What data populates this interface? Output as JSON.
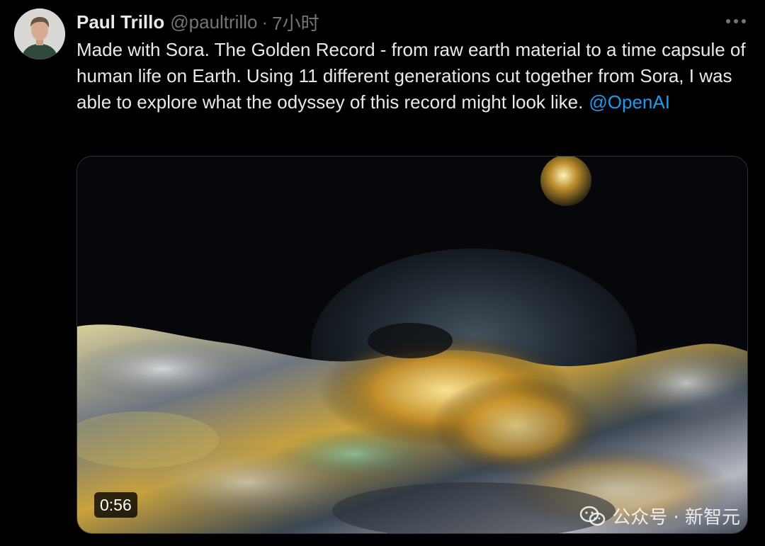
{
  "tweet": {
    "author": {
      "name": "Paul Trillo",
      "handle": "@paultrillo",
      "time": "7小时"
    },
    "separator": "·",
    "text": "Made with Sora. The Golden Record - from raw earth material to a time capsule of human life on Earth. Using 11 different generations cut together from Sora, I was able to explore what the odyssey of this record might look like.",
    "mention": "@OpenAI",
    "media": {
      "type": "video",
      "duration": "0:56"
    }
  },
  "watermark": {
    "text": "公众号 · 新智元"
  },
  "icons": {
    "more": "more-horizontal-icon",
    "watermark": "wechat-icon"
  },
  "colors": {
    "background": "#000000",
    "text": "#e7e9ea",
    "secondary": "#71767b",
    "link": "#1d9bf0"
  }
}
